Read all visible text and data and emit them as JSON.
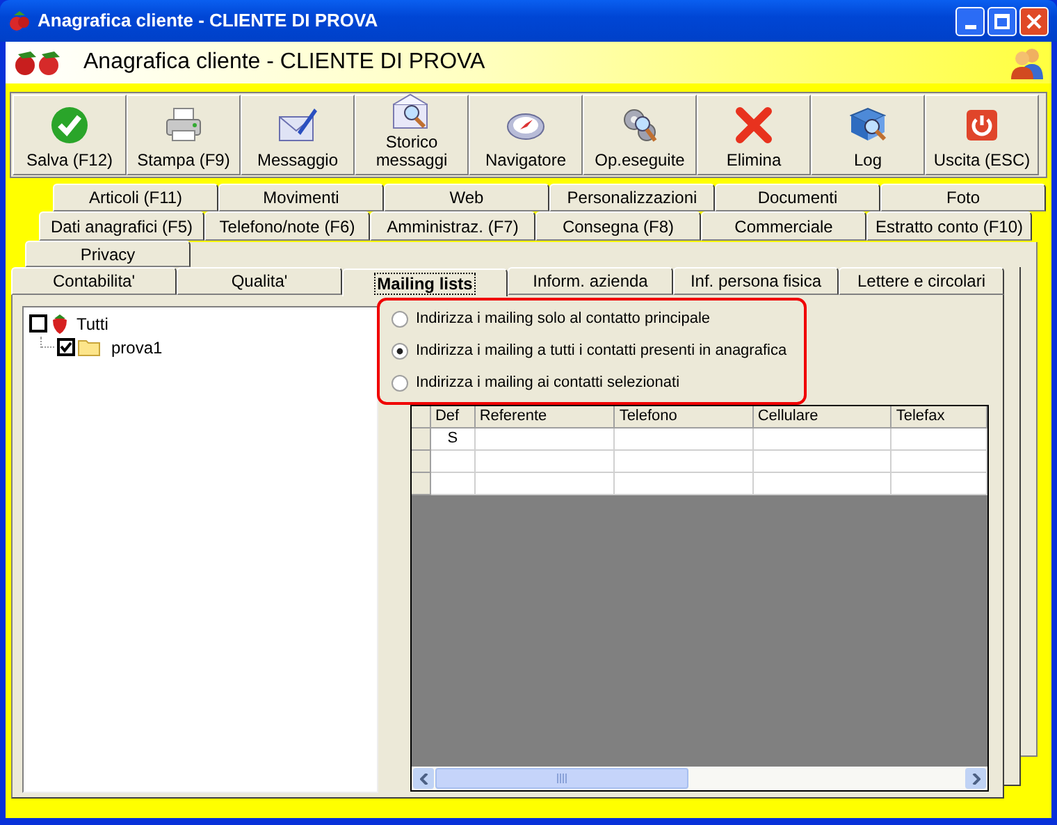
{
  "window": {
    "title": "Anagrafica cliente - CLIENTE DI PROVA"
  },
  "header": {
    "title": "Anagrafica cliente - CLIENTE DI PROVA"
  },
  "toolbar": [
    {
      "label": "Salva (F12)"
    },
    {
      "label": "Stampa (F9)"
    },
    {
      "label": "Messaggio"
    },
    {
      "label": "Storico messaggi"
    },
    {
      "label": "Navigatore"
    },
    {
      "label": "Op.eseguite"
    },
    {
      "label": "Elimina"
    },
    {
      "label": "Log"
    },
    {
      "label": "Uscita (ESC)"
    }
  ],
  "tab_rows": [
    {
      "tabs": [
        {
          "label": "Articoli (F11)",
          "selected": false
        },
        {
          "label": "Movimenti",
          "selected": false
        },
        {
          "label": "Web",
          "selected": false
        },
        {
          "label": "Personalizzazioni",
          "selected": false
        },
        {
          "label": "Documenti",
          "selected": false
        },
        {
          "label": "Foto",
          "selected": false
        }
      ]
    },
    {
      "tabs": [
        {
          "label": "Dati anagrafici (F5)",
          "selected": false
        },
        {
          "label": "Telefono/note (F6)",
          "selected": false
        },
        {
          "label": "Amministraz. (F7)",
          "selected": false
        },
        {
          "label": "Consegna (F8)",
          "selected": false
        },
        {
          "label": "Commerciale",
          "selected": false
        },
        {
          "label": "Estratto conto (F10)",
          "selected": false
        }
      ]
    },
    {
      "tabs": [
        {
          "label": "Privacy",
          "selected": false
        }
      ]
    },
    {
      "tabs": [
        {
          "label": "Contabilita'",
          "selected": false
        },
        {
          "label": "Qualita'",
          "selected": false
        },
        {
          "label": "Mailing lists",
          "selected": true
        },
        {
          "label": "Inform. azienda",
          "selected": false
        },
        {
          "label": "Inf. persona fisica",
          "selected": false
        },
        {
          "label": "Lettere e circolari",
          "selected": false
        }
      ]
    }
  ],
  "tree": [
    {
      "label": "Tutti",
      "checked": false,
      "children": [
        {
          "label": "prova1",
          "checked": true
        }
      ]
    }
  ],
  "mailing_options": [
    {
      "label": "Indirizza i mailing solo al contatto principale",
      "selected": false
    },
    {
      "label": "Indirizza i mailing a tutti i contatti presenti in anagrafica",
      "selected": true
    },
    {
      "label": "Indirizza i mailing ai contatti selezionati",
      "selected": false
    }
  ],
  "grid": {
    "columns": [
      "Def",
      "Referente",
      "Telefono",
      "Cellulare",
      "Telefax"
    ],
    "rows": [
      [
        "S"
      ]
    ]
  }
}
